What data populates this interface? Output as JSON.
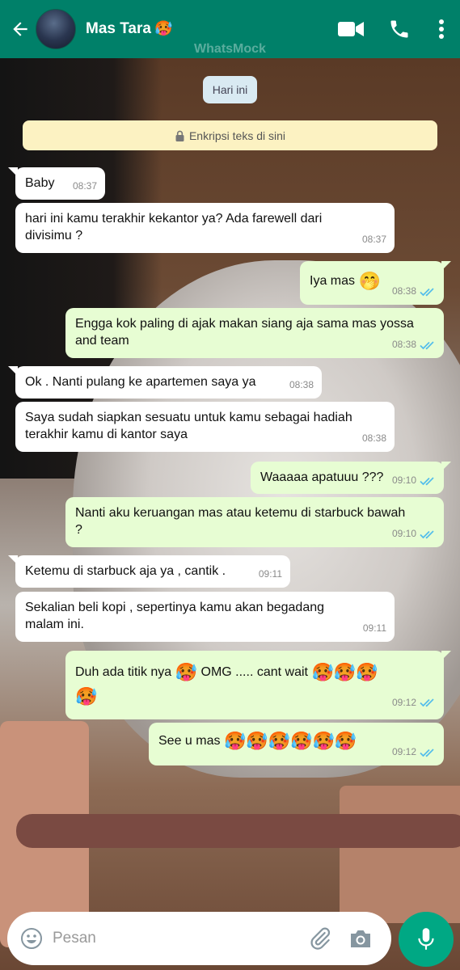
{
  "header": {
    "contact_name": "Mas Tara",
    "contact_emoji": "🥵",
    "watermark": "WhatsMock",
    "colors": {
      "bar": "#008069"
    }
  },
  "chat": {
    "date_chip": "Hari ini",
    "encryption_notice": "Enkripsi teks di sini",
    "messages": [
      {
        "dir": "in",
        "text": "Baby",
        "time": "08:37"
      },
      {
        "dir": "in",
        "text": "hari ini kamu terakhir kekantor ya? Ada farewell dari divisimu ?",
        "time": "08:37"
      },
      {
        "dir": "out",
        "text": "Iya mas",
        "emoji": "🤭",
        "time": "08:38",
        "status": "read"
      },
      {
        "dir": "out",
        "text": "Engga kok paling di ajak makan siang aja sama mas yossa and team",
        "time": "08:38",
        "status": "read"
      },
      {
        "dir": "in",
        "text": "Ok . Nanti pulang ke apartemen saya ya",
        "time": "08:38"
      },
      {
        "dir": "in",
        "text": "Saya sudah siapkan sesuatu untuk kamu sebagai hadiah terakhir kamu di kantor saya",
        "time": "08:38"
      },
      {
        "dir": "out",
        "text": "Waaaaa apatuuu ???",
        "time": "09:10",
        "status": "read"
      },
      {
        "dir": "out",
        "text": "Nanti aku keruangan mas atau ketemu di starbuck bawah ?",
        "time": "09:10",
        "status": "read"
      },
      {
        "dir": "in",
        "text": "Ketemu di starbuck aja ya , cantik .",
        "time": "09:11"
      },
      {
        "dir": "in",
        "text": "Sekalian beli kopi , sepertinya kamu akan begadang malam ini.",
        "time": "09:11"
      },
      {
        "dir": "out",
        "text_a": "Duh ada titik nya",
        "emoji_a": "🥵",
        "text_b": "OMG ..... cant wait",
        "emoji_b": "🥵🥵🥵",
        "emoji_c": "🥵",
        "time": "09:12",
        "status": "read"
      },
      {
        "dir": "out",
        "text": "See u mas",
        "emoji": "🥵🥵🥵🥵🥵🥵",
        "time": "09:12",
        "status": "read"
      }
    ]
  },
  "composer": {
    "placeholder": "Pesan",
    "icons": [
      "smile-icon",
      "paperclip-icon",
      "camera-icon",
      "mic-icon"
    ],
    "colors": {
      "mic": "#00a884"
    }
  },
  "icons": {
    "header": [
      "back-arrow-icon",
      "video-call-icon",
      "phone-icon",
      "more-vertical-icon"
    ],
    "read_tick": "double-check-icon",
    "tick_color": "#53bdeb"
  }
}
